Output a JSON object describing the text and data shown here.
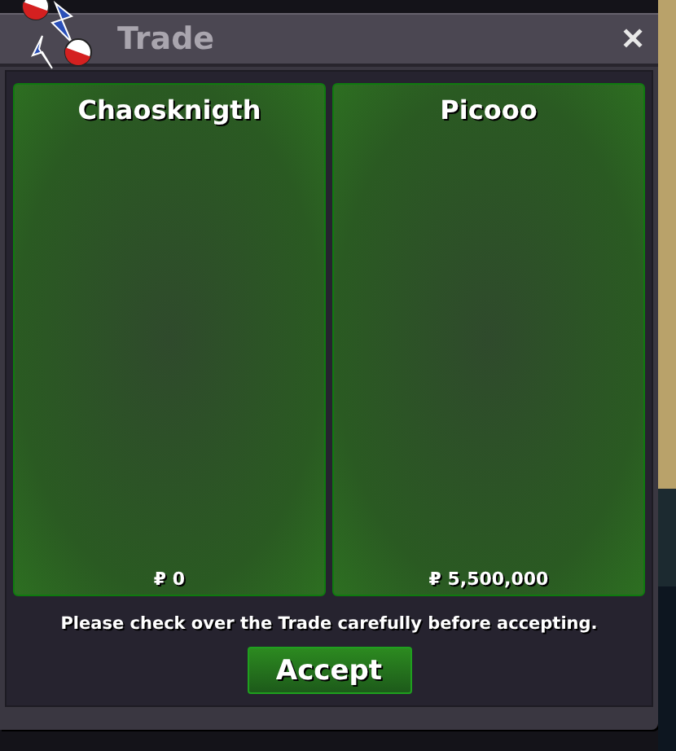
{
  "window": {
    "title": "Trade",
    "close": "✕"
  },
  "offers": [
    {
      "trader": "Chaosknigth",
      "money": "₽ 0"
    },
    {
      "trader": "Picooo",
      "money": "₽ 5,500,000"
    }
  ],
  "notice": "Please check over the Trade carefully before accepting.",
  "buttons": [
    "Accept"
  ]
}
